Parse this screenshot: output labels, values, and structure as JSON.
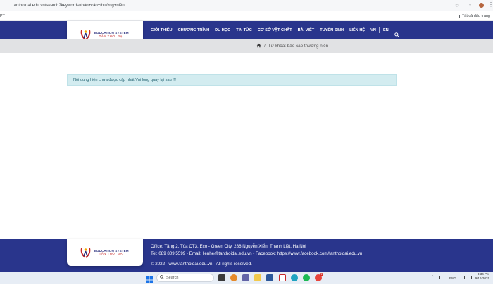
{
  "browser": {
    "url": "tanthoidai.edu.vn/search?keywords=báo+cáo+thường+niên",
    "bookmark_left": "PT",
    "bookmark_right": "Tất cả dấu trang"
  },
  "header": {
    "logo": {
      "line1": "EDUCATION SYSTEM",
      "line2": "TÂN THỜI ĐẠI"
    },
    "nav": [
      "GIỚI THIỆU",
      "CHƯƠNG TRÌNH",
      "DU HỌC",
      "TIN TỨC",
      "CƠ SỞ VẬT CHẤT",
      "BÀI VIẾT",
      "TUYỂN SINH",
      "LIÊN HỆ"
    ],
    "lang_vn": "VN",
    "lang_en": "EN"
  },
  "breadcrumb": {
    "separator": "/",
    "current": "Từ khóa: báo cáo thường niên"
  },
  "notice": "Nội dung hiện chưa được cập nhật.Vui lòng quay lại sau !!!",
  "footer": {
    "logo": {
      "line1": "EDUCATION SYSTEM",
      "line2": "TÂN THỜI ĐẠI"
    },
    "office": "Office: Tầng 2, Tòa CT3, Eco - Green City, 286 Nguyễn Xiển, Thanh Liệt, Hà Nội",
    "contact": "Tel: 089 809 5599 - Email: lienhe@tanthoidai.edu.vn - Facebook: https://www.facebook.com/tanthoidai.edu.vn",
    "copyright": "© 2022 - www.tanthoidai.edu.vn - All rights reserved."
  },
  "taskbar": {
    "search_placeholder": "Search",
    "lang": "ENG",
    "time": "3:34 PM",
    "date": "9/16/2025",
    "badge": "1"
  },
  "colors": {
    "brand_navy": "#29358c",
    "brand_red": "#c62828",
    "notice_bg": "#d3ecf0"
  }
}
